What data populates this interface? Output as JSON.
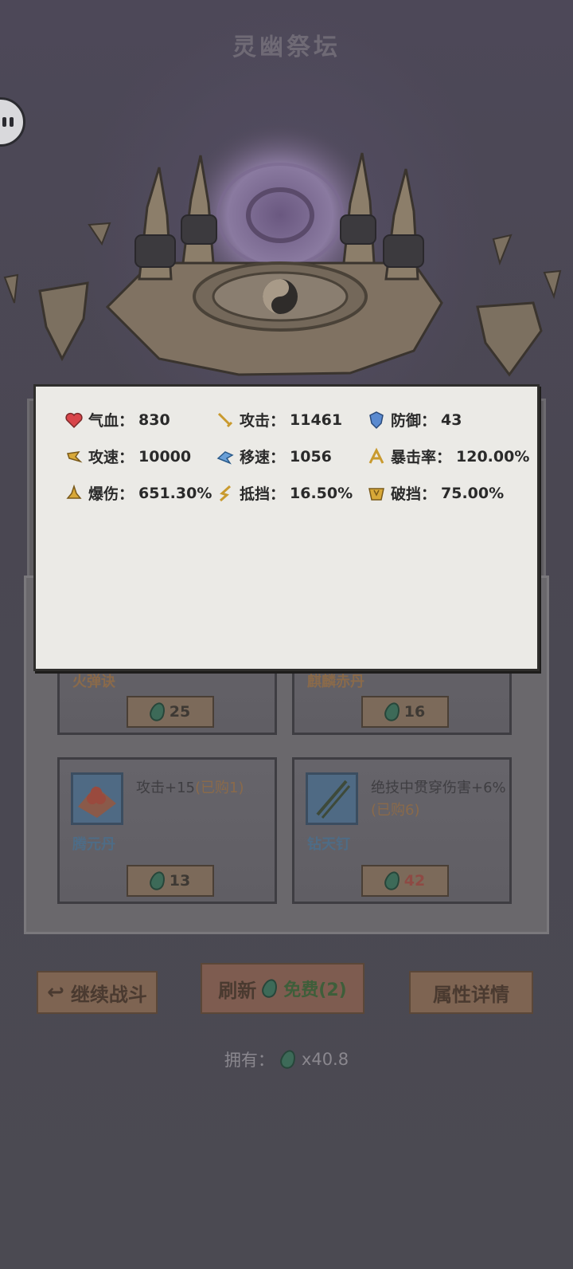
{
  "header": {
    "title": "灵幽祭坛"
  },
  "stats": [
    {
      "label": "气血：",
      "value": "830",
      "icon": "heart-icon"
    },
    {
      "label": "攻击：",
      "value": "11461",
      "icon": "sword-icon"
    },
    {
      "label": "防御：",
      "value": "43",
      "icon": "shield-icon"
    },
    {
      "label": "攻速：",
      "value": "10000",
      "icon": "attack-speed-icon"
    },
    {
      "label": "移速：",
      "value": "1056",
      "icon": "move-speed-icon"
    },
    {
      "label": "暴击率：",
      "value": "120.00%",
      "icon": "crit-rate-icon"
    },
    {
      "label": "爆伤：",
      "value": "651.30%",
      "icon": "crit-damage-icon"
    },
    {
      "label": "抵挡：",
      "value": "16.50%",
      "icon": "block-icon"
    },
    {
      "label": "破挡：",
      "value": "75.00%",
      "icon": "break-block-icon"
    }
  ],
  "shop": {
    "items": [
      {
        "name": "火弹诀",
        "price": "25"
      },
      {
        "name": "麒麟赤丹",
        "price": "16"
      },
      {
        "name": "腾元丹",
        "desc": "攻击+15",
        "bought": "(已购1)",
        "price": "13"
      },
      {
        "name": "钻天钉",
        "desc": "绝技中贯穿伤害+6%",
        "bought": "(已购6)",
        "price": "42"
      }
    ]
  },
  "buttons": {
    "continue": "继续战斗",
    "refresh": "刷新",
    "refresh_free": "免费(2)",
    "detail": "属性详情"
  },
  "owned": {
    "label": "拥有：",
    "value": "x40.8"
  },
  "colors": {
    "panel_bg": "#ebeae6",
    "gem": "#3d6a58",
    "price_red": "#8e4a44"
  }
}
